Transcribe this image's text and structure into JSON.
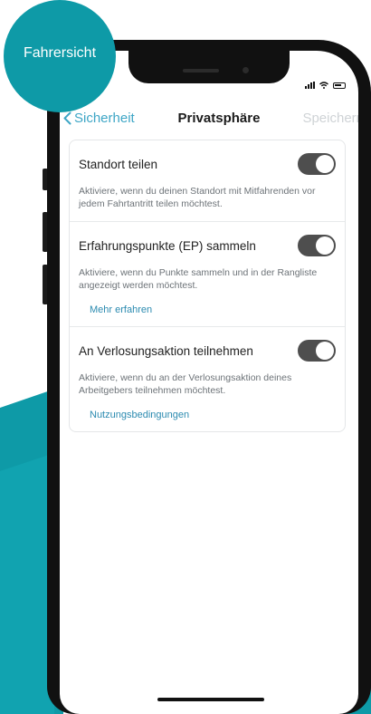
{
  "badge": {
    "label": "Fahrersicht"
  },
  "status_bar": {
    "signal_icon": "signal-icon",
    "wifi_icon": "wifi-icon",
    "battery_icon": "battery-icon"
  },
  "nav": {
    "back_label": "Sicherheit",
    "title": "Privatsphäre",
    "save_label": "Speichern"
  },
  "settings": [
    {
      "label": "Standort teilen",
      "description": "Aktiviere, wenn du deinen Standort mit Mitfahrenden vor jedem Fahrtantritt teilen möchtest.",
      "enabled": true,
      "link": ""
    },
    {
      "label": "Erfahrungspunkte (EP) sammeln",
      "description": "Aktiviere, wenn du Punkte sammeln und in der Rangliste angezeigt werden möchtest.",
      "enabled": true,
      "link": "Mehr erfahren"
    },
    {
      "label": "An Verlosungsaktion teilnehmen",
      "description": "Aktiviere, wenn du an der Verlosungsaktion deines Arbeitgebers teilnehmen möchtest.",
      "enabled": true,
      "link": "Nutzungsbedingungen"
    }
  ],
  "colors": {
    "accent": "#0e9aa7",
    "link": "#2c8bb0",
    "toggle_on": "#4e4e4e"
  }
}
